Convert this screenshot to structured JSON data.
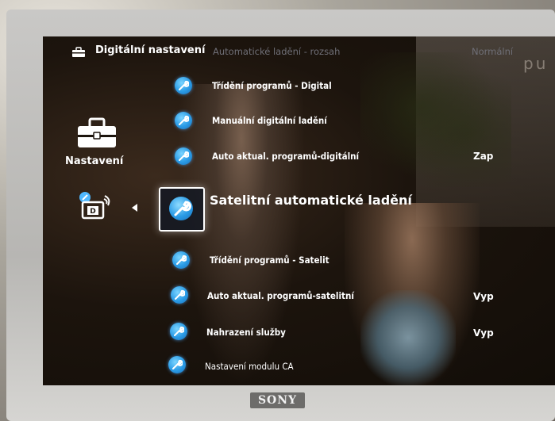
{
  "osd": {
    "header": {
      "title": "Digitální nastavení",
      "current_item": "Automatické ladění - rozsah",
      "current_value": "Normální",
      "bg_text": "pu"
    },
    "category": {
      "label": "Nastavení",
      "icon": "toolbox-icon"
    },
    "submenu_icon": "satellite-tuning-icon",
    "items": [
      {
        "label": "Třídění programů - Digital",
        "value": ""
      },
      {
        "label": "Manuální digitální ladění",
        "value": ""
      },
      {
        "label": "Auto aktual. programů-digitální",
        "value": "Zap"
      },
      {
        "label": "Satelitní automatické ladění",
        "value": "",
        "selected": true
      },
      {
        "label": "Třídění programů - Satelit",
        "value": ""
      },
      {
        "label": "Auto aktual. programů-satelitní",
        "value": "Vyp"
      },
      {
        "label": "Nahrazení služby",
        "value": "Vyp"
      },
      {
        "label": "Nastavení modulu CA",
        "value": ""
      }
    ],
    "accent_color": "#2a9be6"
  },
  "tv": {
    "brand": "SONY"
  }
}
